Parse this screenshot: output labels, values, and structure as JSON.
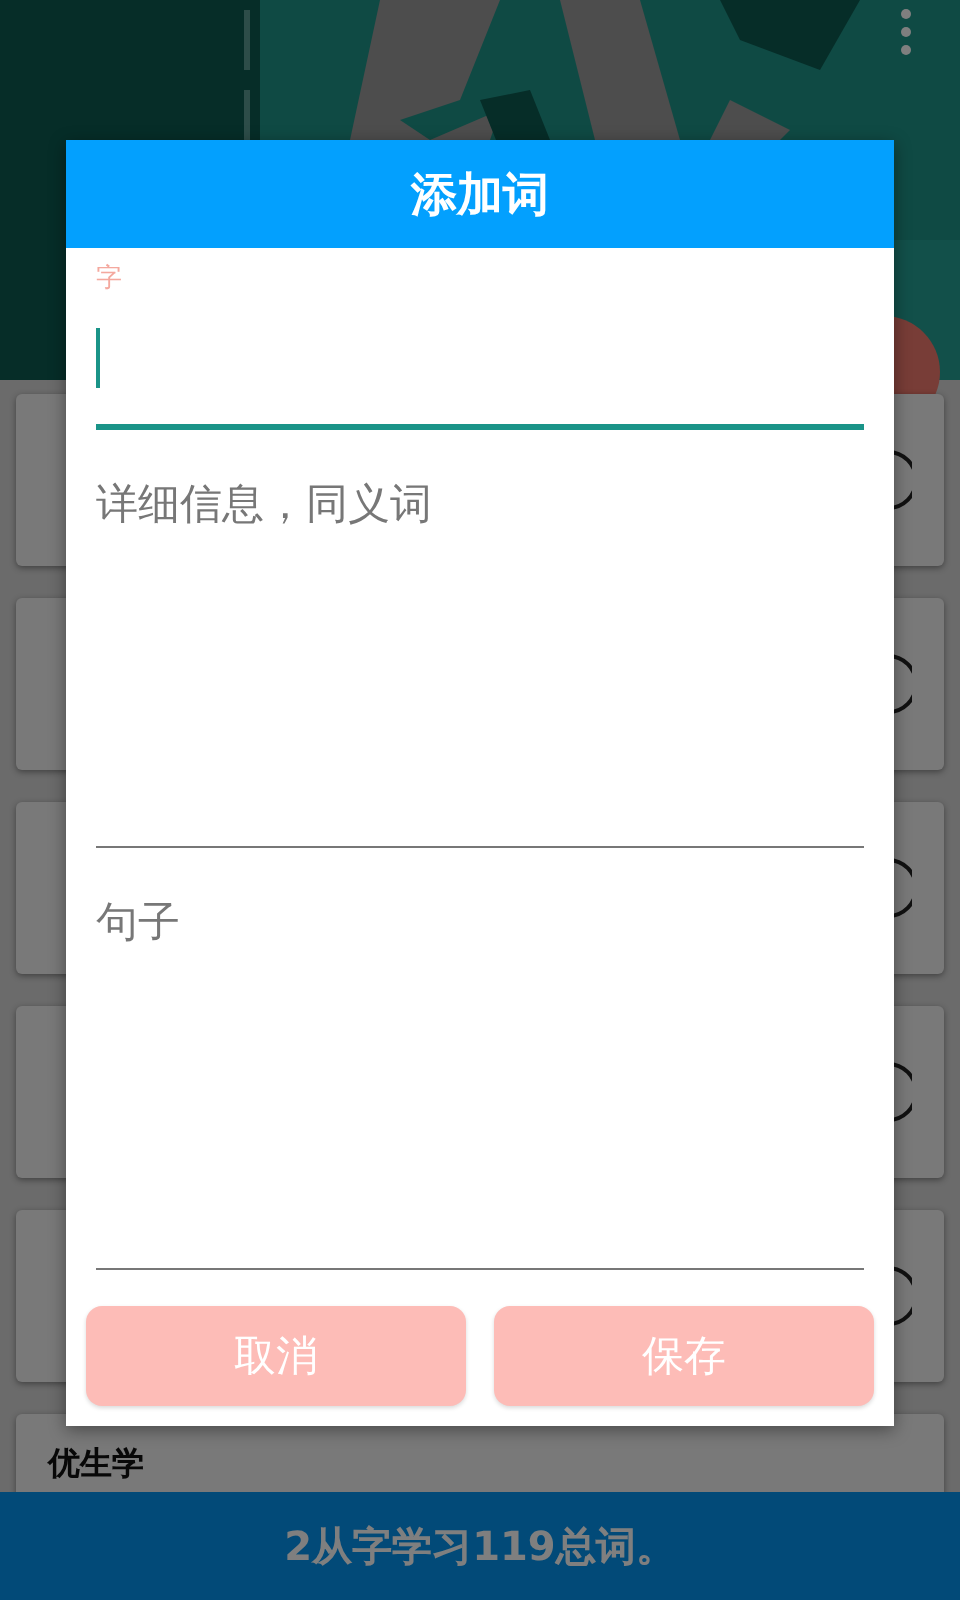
{
  "cards": [
    {
      "kind": "covered"
    },
    {
      "kind": "covered"
    },
    {
      "kind": "covered"
    },
    {
      "kind": "covered"
    },
    {
      "kind": "covered"
    },
    {
      "kind": "word",
      "title": "优生学"
    }
  ],
  "dialog": {
    "title": "添加词",
    "fields": [
      {
        "kind": "input",
        "label": "字",
        "focused": true
      },
      {
        "kind": "textarea",
        "placeholder": "详细信息，同义词",
        "focused": false
      },
      {
        "kind": "textarea",
        "placeholder": "句子",
        "focused": false
      }
    ],
    "buttons": [
      "取消",
      "保存"
    ]
  },
  "footer": "2从字学习119总词。"
}
